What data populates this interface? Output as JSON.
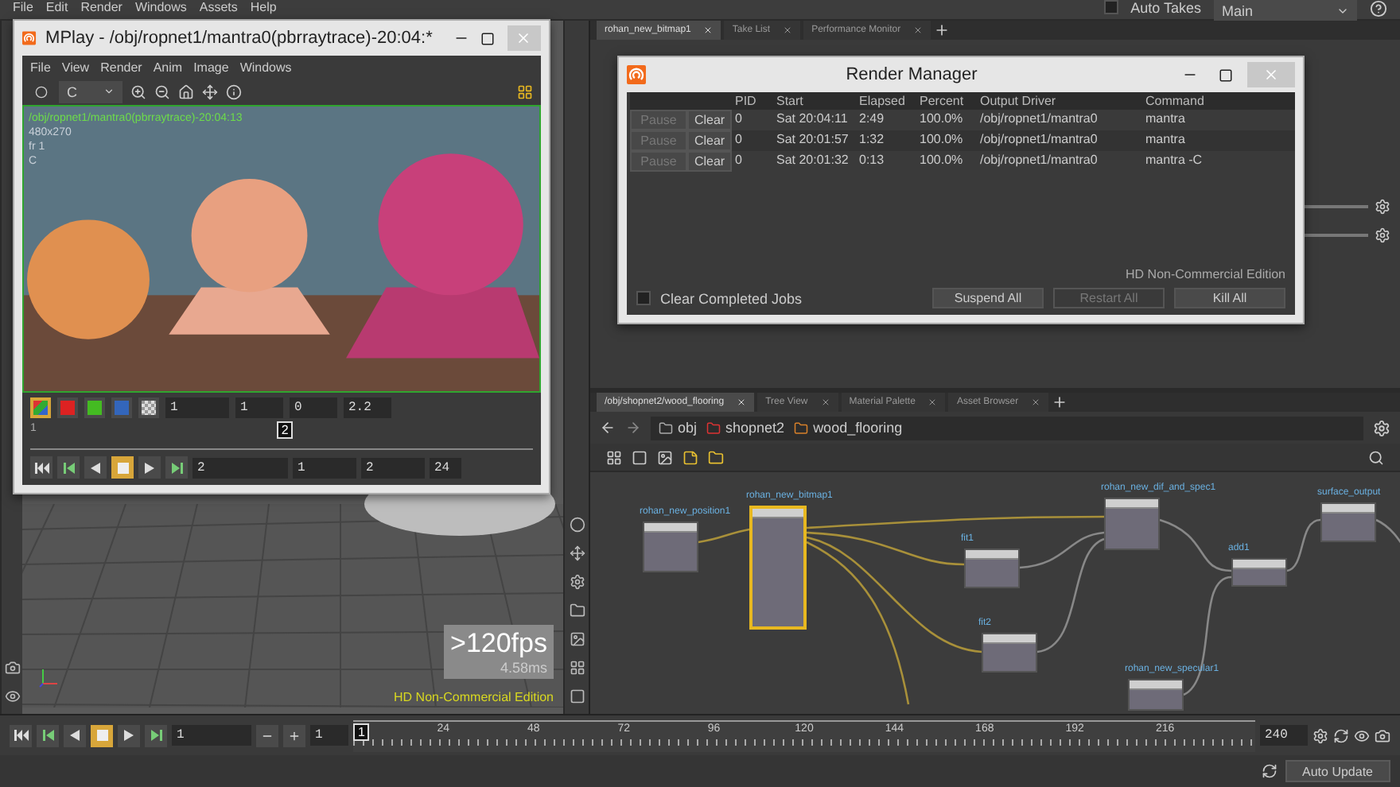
{
  "menu_bar": {
    "items": [
      "File",
      "Edit",
      "Render",
      "Windows",
      "Assets",
      "Help"
    ]
  },
  "takes": {
    "label": "Auto Takes",
    "checked": false,
    "current": "Main"
  },
  "viewport": {
    "fps": ">120fps",
    "frame_time": "4.58ms",
    "edition": "HD Non-Commercial Edition"
  },
  "parameter_pane": {
    "tabs": [
      {
        "label": "rohan_new_bitmap1",
        "selected": true
      },
      {
        "label": "Take List",
        "selected": false
      },
      {
        "label": "Performance Monitor",
        "selected": false
      }
    ]
  },
  "network_pane": {
    "tabs": [
      {
        "label": "/obj/shopnet2/wood_flooring",
        "selected": true
      },
      {
        "label": "Tree View",
        "selected": false
      },
      {
        "label": "Material Palette",
        "selected": false
      },
      {
        "label": "Asset Browser",
        "selected": false
      }
    ],
    "path": [
      {
        "label": "obj"
      },
      {
        "label": "shopnet2"
      },
      {
        "label": "wood_flooring"
      }
    ],
    "nodes": [
      {
        "name": "rohan_new_position1",
        "selected": false
      },
      {
        "name": "rohan_new_bitmap1",
        "selected": true
      },
      {
        "name": "rohan_new_dif_and_spec1",
        "selected": false
      },
      {
        "name": "fit1",
        "selected": false
      },
      {
        "name": "fit2",
        "selected": false
      },
      {
        "name": "add1",
        "selected": false
      },
      {
        "name": "surface_output",
        "selected": false
      },
      {
        "name": "rohan_new_specular1",
        "selected": false
      }
    ]
  },
  "timeline": {
    "transport": [
      {
        "kind": "first",
        "selected": false
      },
      {
        "kind": "prev",
        "selected": false
      },
      {
        "kind": "reverse",
        "selected": false
      },
      {
        "kind": "stop",
        "selected": true
      },
      {
        "kind": "play",
        "selected": false
      },
      {
        "kind": "last",
        "selected": false
      }
    ],
    "frame_field": "1",
    "step_field": "1",
    "marker": "1",
    "ticks": [
      "24",
      "48",
      "72",
      "96",
      "120",
      "144",
      "168",
      "192",
      "216"
    ],
    "end_field": "240"
  },
  "status_bar": {
    "auto_update": "Auto Update"
  },
  "mplay": {
    "title": "MPlay - /obj/ropnet1/mantra0(pbrraytrace)-20:04:*",
    "menu": [
      "File",
      "View",
      "Render",
      "Anim",
      "Image",
      "Windows"
    ],
    "channel": "C",
    "overlay": [
      "/obj/ropnet1/mantra0(pbrraytrace)-20:04:13",
      "480x270",
      "fr 1",
      "C"
    ],
    "channels": [
      {
        "kind": "rgb",
        "selected": true
      },
      {
        "kind": "red",
        "selected": false
      },
      {
        "kind": "green",
        "selected": false
      },
      {
        "kind": "blue",
        "selected": false
      },
      {
        "kind": "alpha",
        "selected": false
      }
    ],
    "adjust_fields": [
      "1",
      "1",
      "0",
      "2.2"
    ],
    "frame_slider": {
      "start": "1",
      "current": "2",
      "level": 0.49
    },
    "transport": [
      {
        "kind": "first",
        "selected": false
      },
      {
        "kind": "prev",
        "selected": false
      },
      {
        "kind": "reverse",
        "selected": false
      },
      {
        "kind": "stop",
        "selected": true
      },
      {
        "kind": "play",
        "selected": false
      },
      {
        "kind": "last",
        "selected": false
      }
    ],
    "playback_fields": [
      "2",
      "1",
      "2"
    ],
    "fps": "24"
  },
  "render_manager": {
    "title": "Render Manager",
    "columns": [
      "PID",
      "Start",
      "Elapsed",
      "Percent",
      "Output Driver",
      "Command"
    ],
    "jobs": [
      {
        "pause": "Pause",
        "pause_disabled": true,
        "clear": "Clear",
        "cells": [
          "0",
          "Sat 20:04:11",
          "2:49",
          "100.0%",
          "/obj/ropnet1/mantra0",
          "mantra"
        ]
      },
      {
        "pause": "Pause",
        "pause_disabled": true,
        "clear": "Clear",
        "cells": [
          "0",
          "Sat 20:01:57",
          "1:32",
          "100.0%",
          "/obj/ropnet1/mantra0",
          "mantra"
        ]
      },
      {
        "pause": "Pause",
        "pause_disabled": true,
        "clear": "Clear",
        "cells": [
          "0",
          "Sat 20:01:32",
          "0:13",
          "100.0%",
          "/obj/ropnet1/mantra0",
          "mantra -C"
        ]
      }
    ],
    "edition": "HD Non-Commercial Edition",
    "clear_completed": {
      "label": "Clear Completed Jobs",
      "checked": false
    },
    "buttons": [
      {
        "label": "Suspend All",
        "disabled": false
      },
      {
        "label": "Restart All",
        "disabled": true
      },
      {
        "label": "Kill All",
        "disabled": false
      }
    ]
  }
}
